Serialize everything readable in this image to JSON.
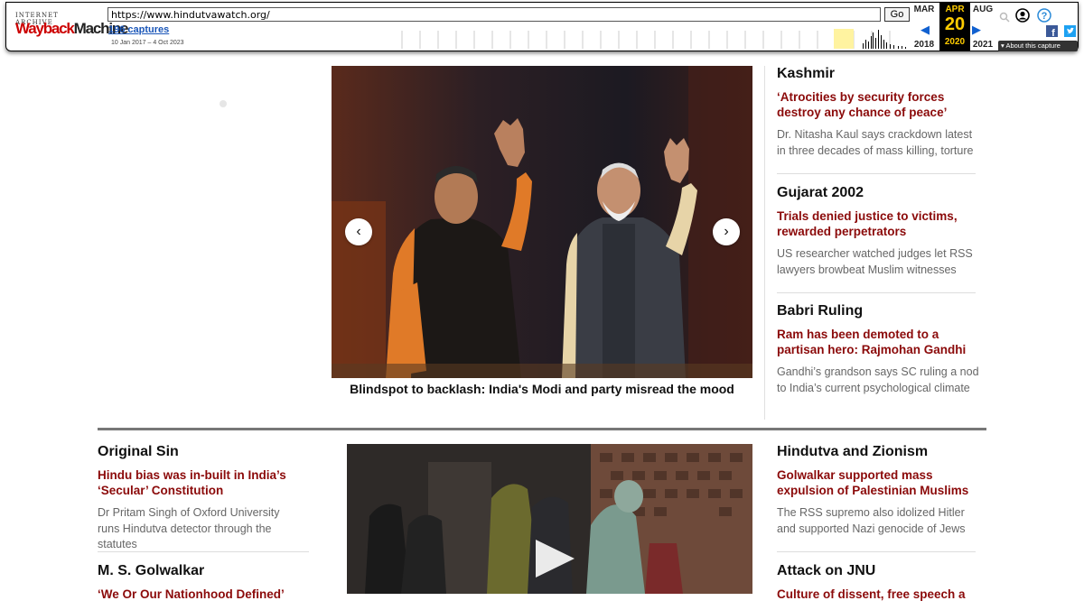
{
  "wayback": {
    "ia_label": "INTERNET ARCHIVE",
    "logo_wayback": "Wayback",
    "logo_machine": "Machine",
    "url": "https://www.hindutvawatch.org/",
    "go_label": "Go",
    "captures": "196 captures",
    "date_range": "10 Jan 2017 – 4 Oct 2023",
    "calendar": {
      "prev": {
        "month": "MAR",
        "year": "2018"
      },
      "current": {
        "month": "APR",
        "day": "20",
        "year": "2020"
      },
      "next": {
        "month": "AUG",
        "year": "2021"
      }
    },
    "about": "About this capture",
    "icons": [
      "user-icon",
      "help-icon",
      "facebook-icon",
      "twitter-icon",
      "search-icon"
    ],
    "colors": {
      "logo_red": "#c00000",
      "cal_highlight": "#ffcc00",
      "link_blue": "#1a56b8"
    }
  },
  "hero": {
    "caption": "Blindspot to backlash: India's Modi and party misread the mood",
    "prev_icon": "chevron-left-icon",
    "next_icon": "chevron-right-icon"
  },
  "right_column": [
    {
      "section": "Kashmir",
      "headline": "‘Atrocities by security forces destroy any chance of peace’",
      "dek": "Dr. Nitasha Kaul says crackdown latest in three decades of mass killing, torture"
    },
    {
      "section": "Gujarat 2002",
      "headline": "Trials denied justice to victims, rewarded perpetrators",
      "dek": "US researcher watched judges let RSS lawyers browbeat Muslim witnesses"
    },
    {
      "section": "Babri Ruling",
      "headline": "Ram has been demoted to a partisan hero: Rajmohan Gandhi",
      "dek": "Gandhi’s grandson says SC ruling a nod to India’s current psychological climate"
    }
  ],
  "lower_left": [
    {
      "section": "Original Sin",
      "headline": "Hindu bias was in-built in India’s ‘Secular’ Constitution",
      "dek": "Dr Pritam Singh of  Oxford University runs Hindutva detector through the statutes"
    },
    {
      "section": "M. S. Golwalkar",
      "headline": "‘We Or Our Nationhood Defined’",
      "dek": ""
    }
  ],
  "lower_right": [
    {
      "section": "Hindutva and Zionism",
      "headline": "Golwalkar supported mass expulsion of Palestinian Muslims",
      "dek": "The RSS supremo also idolized Hitler and supported Nazi genocide of Jews"
    },
    {
      "section": "Attack on JNU",
      "headline": "Culture of dissent, free speech a",
      "dek": ""
    }
  ],
  "video": {
    "play_icon": "play-icon"
  },
  "colors": {
    "headline": "#8b0a0a",
    "rule": "#777777"
  }
}
